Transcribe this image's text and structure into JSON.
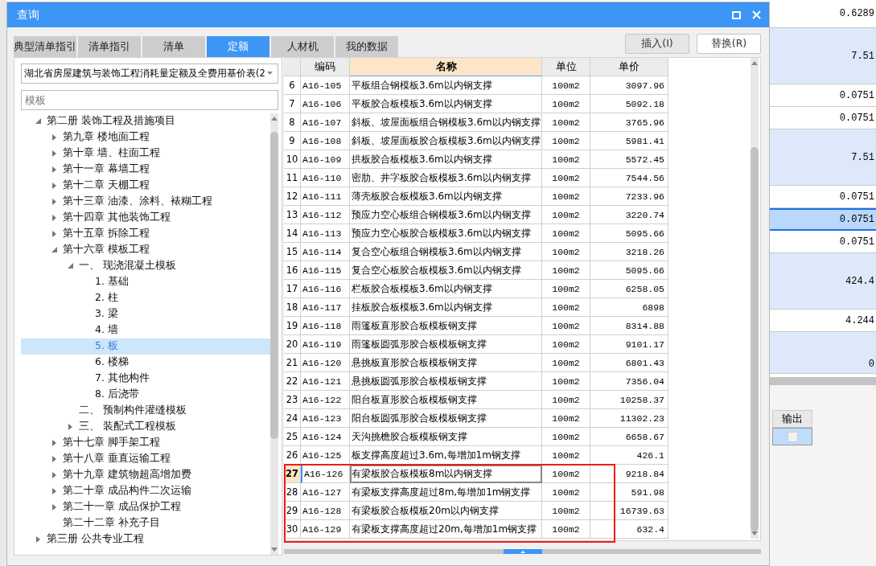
{
  "window": {
    "title": "查询"
  },
  "tabs": [
    {
      "label": "典型清单指引",
      "selected": false
    },
    {
      "label": "清单指引",
      "selected": false
    },
    {
      "label": "清单",
      "selected": false
    },
    {
      "label": "定额",
      "selected": true
    },
    {
      "label": "人材机",
      "selected": false
    },
    {
      "label": "我的数据",
      "selected": false
    }
  ],
  "buttons": [
    "插入(I)",
    "替换(R)"
  ],
  "library_dropdown": {
    "value": "湖北省房屋建筑与装饰工程消耗量定额及全费用基价表(2"
  },
  "search": {
    "placeholder": "模板"
  },
  "tree": [
    {
      "label": "第二册 装饰工程及措施项目",
      "kind": "branch",
      "expanded": true,
      "selected": false,
      "children": [
        {
          "label": "第九章 楼地面工程",
          "kind": "branch",
          "expanded": false,
          "selected": false
        },
        {
          "label": "第十章 墙、柱面工程",
          "kind": "branch",
          "expanded": false,
          "selected": false
        },
        {
          "label": "第十一章 幕墙工程",
          "kind": "branch",
          "expanded": false,
          "selected": false
        },
        {
          "label": "第十二章 天棚工程",
          "kind": "branch",
          "expanded": false,
          "selected": false
        },
        {
          "label": "第十三章 油漆、涂料、裱糊工程",
          "kind": "branch",
          "expanded": false,
          "selected": false
        },
        {
          "label": "第十四章 其他装饰工程",
          "kind": "branch",
          "expanded": false,
          "selected": false
        },
        {
          "label": "第十五章 拆除工程",
          "kind": "branch",
          "expanded": false,
          "selected": false
        },
        {
          "label": "第十六章 模板工程",
          "kind": "branch",
          "expanded": true,
          "selected": false,
          "children": [
            {
              "label": "一、 现浇混凝土模板",
              "kind": "branch",
              "expanded": true,
              "selected": false,
              "children": [
                {
                  "label": "1. 基础",
                  "kind": "leaf",
                  "selected": false
                },
                {
                  "label": "2. 柱",
                  "kind": "leaf",
                  "selected": false
                },
                {
                  "label": "3. 梁",
                  "kind": "leaf",
                  "selected": false
                },
                {
                  "label": "4. 墙",
                  "kind": "leaf",
                  "selected": false
                },
                {
                  "label": "5. 板",
                  "kind": "leaf",
                  "selected": true
                },
                {
                  "label": "6. 楼梯",
                  "kind": "leaf",
                  "selected": false
                },
                {
                  "label": "7. 其他构件",
                  "kind": "leaf",
                  "selected": false
                },
                {
                  "label": "8. 后浇带",
                  "kind": "leaf",
                  "selected": false
                }
              ]
            },
            {
              "label": "二、 预制构件灌缝模板",
              "kind": "leaf",
              "selected": false
            },
            {
              "label": "三、 装配式工程模板",
              "kind": "branch",
              "expanded": false,
              "selected": false
            }
          ]
        },
        {
          "label": "第十七章 脚手架工程",
          "kind": "branch",
          "expanded": false,
          "selected": false
        },
        {
          "label": "第十八章 垂直运输工程",
          "kind": "branch",
          "expanded": false,
          "selected": false
        },
        {
          "label": "第十九章 建筑物超高增加费",
          "kind": "branch",
          "expanded": false,
          "selected": false
        },
        {
          "label": "第二十章 成品构件二次运输",
          "kind": "branch",
          "expanded": false,
          "selected": false
        },
        {
          "label": "第二十一章 成品保护工程",
          "kind": "branch",
          "expanded": false,
          "selected": false
        },
        {
          "label": "第二十二章 补充子目",
          "kind": "leaf",
          "selected": false
        }
      ]
    },
    {
      "label": "第三册 公共专业工程",
      "kind": "branch",
      "expanded": false,
      "selected": false
    }
  ],
  "table": {
    "columns": [
      {
        "label": "编码",
        "selected": false
      },
      {
        "label": "名称",
        "selected": true
      },
      {
        "label": "单位",
        "selected": false
      },
      {
        "label": "单价",
        "selected": false
      }
    ],
    "rows": [
      {
        "number": "6",
        "code": "A16-105",
        "name": "平板组合钢模板3.6m以内钢支撑",
        "unit": "100m2",
        "price": "3097.96",
        "selected": false
      },
      {
        "number": "7",
        "code": "A16-106",
        "name": "平板胶合板模板3.6m以内钢支撑",
        "unit": "100m2",
        "price": "5092.18",
        "selected": false
      },
      {
        "number": "8",
        "code": "A16-107",
        "name": "斜板、坡屋面板组合钢模板3.6m以内钢支撑",
        "unit": "100m2",
        "price": "3765.96",
        "selected": false
      },
      {
        "number": "9",
        "code": "A16-108",
        "name": "斜板、坡屋面板胶合板模板3.6m以内钢支撑",
        "unit": "100m2",
        "price": "5981.41",
        "selected": false
      },
      {
        "number": "10",
        "code": "A16-109",
        "name": "拱板胶合板模板3.6m以内钢支撑",
        "unit": "100m2",
        "price": "5572.45",
        "selected": false
      },
      {
        "number": "11",
        "code": "A16-110",
        "name": "密肋、井字板胶合板模板3.6m以内钢支撑",
        "unit": "100m2",
        "price": "7544.56",
        "selected": false
      },
      {
        "number": "12",
        "code": "A16-111",
        "name": "薄壳板胶合板模板3.6m以内钢支撑",
        "unit": "100m2",
        "price": "7233.96",
        "selected": false
      },
      {
        "number": "13",
        "code": "A16-112",
        "name": "预应力空心板组合钢模板3.6m以内钢支撑",
        "unit": "100m2",
        "price": "3220.74",
        "selected": false
      },
      {
        "number": "14",
        "code": "A16-113",
        "name": "预应力空心板胶合板模板3.6m以内钢支撑",
        "unit": "100m2",
        "price": "5095.66",
        "selected": false
      },
      {
        "number": "15",
        "code": "A16-114",
        "name": "复合空心板组合钢模板3.6m以内钢支撑",
        "unit": "100m2",
        "price": "3218.26",
        "selected": false
      },
      {
        "number": "16",
        "code": "A16-115",
        "name": "复合空心板胶合板模板3.6m以内钢支撑",
        "unit": "100m2",
        "price": "5095.66",
        "selected": false
      },
      {
        "number": "17",
        "code": "A16-116",
        "name": "栏板胶合板模板3.6m以内钢支撑",
        "unit": "100m2",
        "price": "6258.05",
        "selected": false
      },
      {
        "number": "18",
        "code": "A16-117",
        "name": "挂板胶合板模板3.6m以内钢支撑",
        "unit": "100m2",
        "price": "6898",
        "selected": false
      },
      {
        "number": "19",
        "code": "A16-118",
        "name": "雨篷板直形胶合板模板钢支撑",
        "unit": "100m2",
        "price": "8314.88",
        "selected": false
      },
      {
        "number": "20",
        "code": "A16-119",
        "name": "雨篷板圆弧形胶合板模板钢支撑",
        "unit": "100m2",
        "price": "9101.17",
        "selected": false
      },
      {
        "number": "21",
        "code": "A16-120",
        "name": "悬挑板直形胶合板模板钢支撑",
        "unit": "100m2",
        "price": "6801.43",
        "selected": false
      },
      {
        "number": "22",
        "code": "A16-121",
        "name": "悬挑板圆弧形胶合板模板钢支撑",
        "unit": "100m2",
        "price": "7356.04",
        "selected": false
      },
      {
        "number": "23",
        "code": "A16-122",
        "name": "阳台板直形胶合板模板钢支撑",
        "unit": "100m2",
        "price": "10258.37",
        "selected": false
      },
      {
        "number": "24",
        "code": "A16-123",
        "name": "阳台板圆弧形胶合板模板钢支撑",
        "unit": "100m2",
        "price": "11302.23",
        "selected": false
      },
      {
        "number": "25",
        "code": "A16-124",
        "name": "天沟挑檐胶合板模板钢支撑",
        "unit": "100m2",
        "price": "6658.67",
        "selected": false
      },
      {
        "number": "26",
        "code": "A16-125",
        "name": "板支撑高度超过3.6m,每增加1m钢支撑",
        "unit": "100m2",
        "price": "426.1",
        "selected": false
      },
      {
        "number": "27",
        "code": "A16-126",
        "name": "有梁板胶合板模板8m以内钢支撑",
        "unit": "100m2",
        "price": "9218.84",
        "selected": true
      },
      {
        "number": "28",
        "code": "A16-127",
        "name": "有梁板支撑高度超过8m,每增加1m钢支撑",
        "unit": "100m2",
        "price": "591.98",
        "selected": false
      },
      {
        "number": "29",
        "code": "A16-128",
        "name": "有梁板胶合板模板20m以内钢支撑",
        "unit": "100m2",
        "price": "16739.63",
        "selected": false
      },
      {
        "number": "30",
        "code": "A16-129",
        "name": "有梁板支撑高度超过20m,每增加1m钢支撑",
        "unit": "100m2",
        "price": "632.4",
        "selected": false
      }
    ]
  },
  "background": {
    "rows": [
      {
        "value": "0.6289",
        "kind": "top",
        "selected": false
      },
      {
        "value": "7.51",
        "kind": "group",
        "selected": false
      },
      {
        "value": "0.0751",
        "kind": "item",
        "selected": false
      },
      {
        "value": "0.0751",
        "kind": "item",
        "selected": false
      },
      {
        "value": "7.51",
        "kind": "group",
        "selected": false
      },
      {
        "value": "0.0751",
        "kind": "item",
        "selected": false
      },
      {
        "value": "0.0751",
        "kind": "item",
        "selected": true
      },
      {
        "value": "0.0751",
        "kind": "item",
        "selected": false
      },
      {
        "value": "424.4",
        "kind": "group",
        "selected": false
      },
      {
        "value": "4.244",
        "kind": "item",
        "selected": false
      },
      {
        "value": "0",
        "kind": "bottom",
        "selected": false
      }
    ],
    "output_column": {
      "label": "输出",
      "checked": false
    }
  }
}
